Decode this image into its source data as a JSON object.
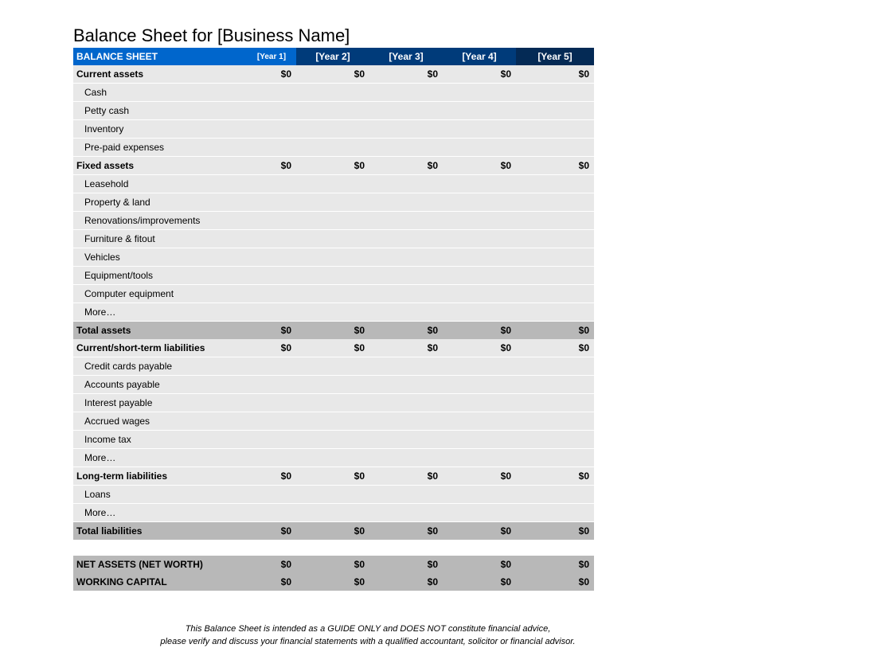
{
  "title": "Balance Sheet for [Business Name]",
  "header": {
    "label": "BALANCE SHEET",
    "year1": "[Year 1]",
    "year2": "[Year 2]",
    "year3": "[Year 3]",
    "year4": "[Year 4]",
    "year5": "[Year 5]"
  },
  "sections": {
    "current_assets": {
      "label": "Current assets",
      "vals": [
        "$0",
        "$0",
        "$0",
        "$0",
        "$0"
      ],
      "items": [
        {
          "label": "Cash"
        },
        {
          "label": "Petty cash"
        },
        {
          "label": "Inventory"
        },
        {
          "label": "Pre-paid expenses"
        }
      ]
    },
    "fixed_assets": {
      "label": "Fixed assets",
      "vals": [
        "$0",
        "$0",
        "$0",
        "$0",
        "$0"
      ],
      "items": [
        {
          "label": "Leasehold"
        },
        {
          "label": "Property & land"
        },
        {
          "label": "Renovations/improvements"
        },
        {
          "label": "Furniture & fitout"
        },
        {
          "label": "Vehicles"
        },
        {
          "label": "Equipment/tools"
        },
        {
          "label": "Computer equipment"
        },
        {
          "label": "More…"
        }
      ]
    },
    "total_assets": {
      "label": "Total assets",
      "vals": [
        "$0",
        "$0",
        "$0",
        "$0",
        "$0"
      ]
    },
    "current_liabilities": {
      "label": "Current/short-term liabilities",
      "vals": [
        "$0",
        "$0",
        "$0",
        "$0",
        "$0"
      ],
      "items": [
        {
          "label": "Credit cards payable"
        },
        {
          "label": "Accounts payable"
        },
        {
          "label": "Interest payable"
        },
        {
          "label": "Accrued wages"
        },
        {
          "label": "Income tax"
        },
        {
          "label": "More…"
        }
      ]
    },
    "long_term_liabilities": {
      "label": "Long-term liabilities",
      "vals": [
        "$0",
        "$0",
        "$0",
        "$0",
        "$0"
      ],
      "items": [
        {
          "label": "Loans"
        },
        {
          "label": "More…"
        }
      ]
    },
    "total_liabilities": {
      "label": "Total liabilities",
      "vals": [
        "$0",
        "$0",
        "$0",
        "$0",
        "$0"
      ]
    },
    "net_assets": {
      "label": "NET ASSETS (NET WORTH)",
      "vals": [
        "$0",
        "$0",
        "$0",
        "$0",
        "$0"
      ]
    },
    "working_capital": {
      "label": "WORKING CAPITAL",
      "vals": [
        "$0",
        "$0",
        "$0",
        "$0",
        "$0"
      ]
    }
  },
  "disclaimer": {
    "line1": "This Balance Sheet is intended as a GUIDE ONLY and DOES NOT constitute financial advice,",
    "line2": "please verify and discuss your financial statements with a qualified accountant, solicitor or financial advisor."
  }
}
